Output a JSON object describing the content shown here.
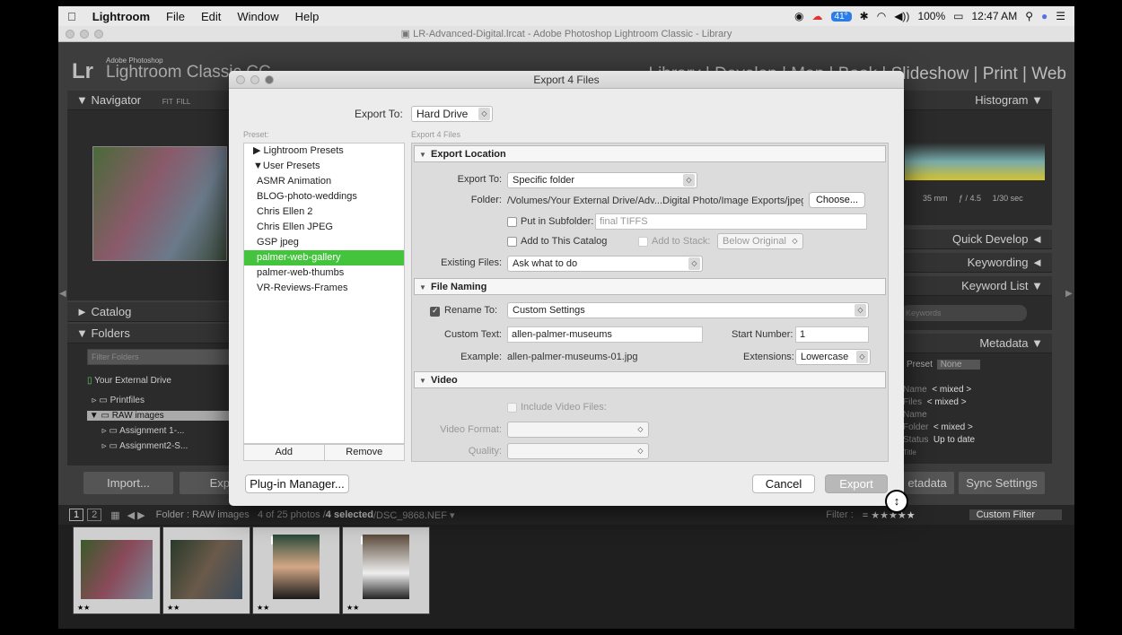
{
  "menubar": {
    "apple": "",
    "app": "Lightroom",
    "items": [
      "File",
      "Edit",
      "Window",
      "Help"
    ],
    "battery_temp": "41°",
    "battery_pct": "100%",
    "time": "12:47 AM"
  },
  "window": {
    "title": "LR-Advanced-Digital.lrcat - Adobe Photoshop Lightroom Classic - Library"
  },
  "identity": {
    "logo": "Lr",
    "small": "Adobe Photoshop",
    "big": "Lightroom Classic CC"
  },
  "modules": [
    "Library",
    "Develop",
    "Map",
    "Book",
    "Slideshow",
    "Print",
    "Web"
  ],
  "left_panel": {
    "navigator": "Navigator",
    "fit": "FIT",
    "fill": "FILL",
    "catalog": "Catalog",
    "folders": "Folders",
    "filter_placeholder": "Filter Folders",
    "drive": "Your External Drive",
    "folders_list": [
      "Printfiles",
      "RAW images",
      "Assignment 1-...",
      "Assignment2-S..."
    ],
    "import": "Import...",
    "export": "Exp"
  },
  "right_panel": {
    "histogram": "Histogram",
    "focal": "35 mm",
    "fstop": "ƒ / 4.5",
    "shutter": "1/30 sec",
    "quick_develop": "Quick Develop",
    "keywording": "Keywording",
    "keyword_list": "Keyword List",
    "keyword_filter": "Keywords",
    "metadata": "Metadata",
    "preset_label": "Preset",
    "preset_value": "None",
    "meta_rows": [
      {
        "k": "Name",
        "v": "< mixed >"
      },
      {
        "k": "Files",
        "v": "< mixed >"
      },
      {
        "k": "Name",
        "v": ""
      },
      {
        "k": "Folder",
        "v": "< mixed >"
      },
      {
        "k": "Status",
        "v": "Up to date"
      }
    ],
    "title_lbl": "Title",
    "sync_meta": "etadata",
    "sync_settings": "Sync Settings"
  },
  "filmbar": {
    "page1": "1",
    "page2": "2",
    "folder_label": "Folder :",
    "folder": "RAW images",
    "count": "4 of 25 photos /",
    "selected": "4 selected",
    "file": "/DSC_9868.NEF ▾",
    "filter_label": "Filter :",
    "filter_value": "Custom Filter"
  },
  "filmstrip": {
    "stars": [
      "★★",
      "★★",
      "★★",
      "★★"
    ],
    "badges": [
      "",
      "",
      "2",
      "2"
    ]
  },
  "dialog": {
    "title": "Export 4 Files",
    "export_to_label": "Export To:",
    "export_to_value": "Hard Drive",
    "preset_label": "Preset:",
    "subtitle": "Export 4 Files",
    "presets": {
      "lr_group": "▶ Lightroom Presets",
      "user_group": "▼User Presets",
      "items": [
        "ASMR Animation",
        "BLOG-photo-weddings",
        "Chris Ellen 2",
        "Chris Ellen JPEG",
        "GSP jpeg",
        "palmer-web-gallery",
        "palmer-web-thumbs",
        "VR-Reviews-Frames"
      ]
    },
    "add": "Add",
    "remove": "Remove",
    "loc": {
      "header": "Export Location",
      "export_to_label": "Export To:",
      "export_to_value": "Specific folder",
      "folder_label": "Folder:",
      "folder_path": "/Volumes/Your External Drive/Adv...Digital Photo/Image Exports/jpegs",
      "choose": "Choose...",
      "subfolder_label": "Put in Subfolder:",
      "subfolder_value": "final TIFFS",
      "add_catalog": "Add to This Catalog",
      "add_stack": "Add to Stack:",
      "below_original": "Below Original",
      "existing_label": "Existing Files:",
      "existing_value": "Ask what to do"
    },
    "naming": {
      "header": "File Naming",
      "rename_label": "Rename To:",
      "rename_value": "Custom Settings",
      "custom_text_label": "Custom Text:",
      "custom_text": "allen-palmer-museums",
      "start_label": "Start Number:",
      "start_value": "1",
      "example_label": "Example:",
      "example_value": "allen-palmer-museums-01.jpg",
      "ext_label": "Extensions:",
      "ext_value": "Lowercase"
    },
    "video": {
      "header": "Video",
      "include": "Include Video Files:",
      "format_label": "Video Format:",
      "quality_label": "Quality:"
    },
    "plugin": "Plug-in Manager...",
    "cancel": "Cancel",
    "export": "Export"
  }
}
